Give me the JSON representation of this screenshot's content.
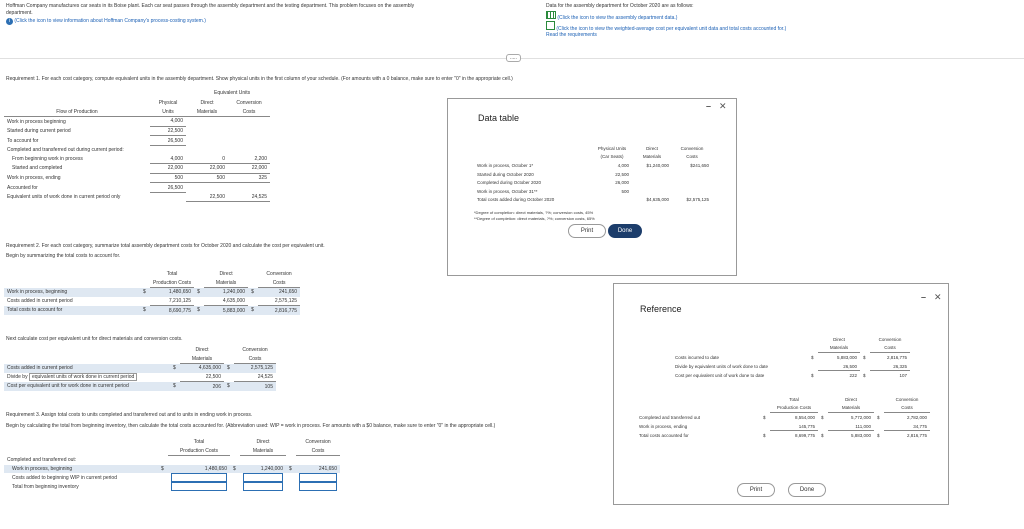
{
  "problem": {
    "intro1": "Hoffman Company manufactures car seats in its Boise plant. Each car seat passes through the assembly department and the testing department. This problem focuses on the assembly",
    "intro2": "department.",
    "link_left": "(Click the icon to view information about Hoffman Company's process-costing system.)",
    "data_intro": "Data for the assembly department for October 2020 are as follows:",
    "link_data": "(Click the icon to view the assembly department data.)",
    "link_wavg": "(Click the icon to view the weighted-average cost per equivalent unit data and total costs accounted for.)",
    "read_req": "Read the requirements",
    "collapse": "....."
  },
  "req1": {
    "title": "Requirement 1. For each cost category, compute equivalent units in the assembly department. Show physical units in the first column of your schedule. (For amounts with a 0 balance, make sure to enter \"0\" in the appropriate cell.)",
    "group_header": "Equivalent Units",
    "h_physical": "Physical",
    "h_units": "Units",
    "h_direct": "Direct",
    "h_materials": "Materials",
    "h_conv": "Conversion",
    "h_costs": "Costs",
    "h_flow": "Flow of Production",
    "rows": [
      {
        "label": "Work in process beginning",
        "p": "4,000",
        "d": "",
        "c": ""
      },
      {
        "label": "Started during current period",
        "p": "22,500",
        "d": "",
        "c": ""
      },
      {
        "label": "To account for",
        "p": "26,500",
        "d": "",
        "c": ""
      },
      {
        "label": "Completed and transferred out during current period:",
        "p": "",
        "d": "",
        "c": ""
      },
      {
        "label": "From beginning work in process",
        "p": "4,000",
        "d": "0",
        "c": "2,200"
      },
      {
        "label": "Started and completed",
        "p": "22,000",
        "d": "22,000",
        "c": "22,000"
      },
      {
        "label": "Work in process, ending",
        "p": "500",
        "d": "500",
        "c": "325"
      },
      {
        "label": "Accounted for",
        "p": "26,500",
        "d": "",
        "c": ""
      },
      {
        "label": "Equivalent units of work done in current period only",
        "p": "",
        "d": "22,500",
        "c": "24,525"
      }
    ]
  },
  "req2": {
    "title": "Requirement 2. For each cost category, summarize total assembly department costs for October 2020 and calculate the cost per equivalent unit.",
    "sub": "Begin by summarizing the total costs to account for.",
    "h_total": "Total",
    "h_prod": "Production Costs",
    "h_direct": "Direct",
    "h_materials": "Materials",
    "h_conv": "Conversion",
    "h_costs": "Costs",
    "rows": [
      {
        "label": "Work in process, beginning",
        "s1": "$",
        "t": "1,480,650",
        "s2": "$",
        "d": "1,240,000",
        "s3": "$",
        "c": "241,650"
      },
      {
        "label": "Costs added in current period",
        "s1": "",
        "t": "7,210,125",
        "s2": "",
        "d": "4,635,000",
        "s3": "",
        "c": "2,575,125"
      },
      {
        "label": "Total costs to account for",
        "s1": "$",
        "t": "8,690,775",
        "s2": "$",
        "d": "5,883,000",
        "s3": "$",
        "c": "2,816,775"
      }
    ],
    "sub2": "Next calculate cost per equivalent unit for direct materials and conversion costs.",
    "h2_direct": "Direct",
    "h2_materials": "Materials",
    "h2_conv": "Conversion",
    "h2_costs": "Costs",
    "rows2": [
      {
        "label": "Costs added in current period",
        "s1": "$",
        "d": "4,635,000",
        "s2": "$",
        "c": "2,575,125"
      },
      {
        "label": "Divide by",
        "label2": "equivalent units of work done in current period",
        "s1": "",
        "d": "22,500",
        "s2": "",
        "c": "24,525"
      },
      {
        "label": "Cost per equivalent unit for work done in current period",
        "s1": "$",
        "d": "206",
        "s2": "$",
        "c": "105"
      }
    ]
  },
  "req3": {
    "title": "Requirement 3. Assign total costs to units completed and transferred out and to units in ending work in process.",
    "sub": "Begin by calculating the total from beginning inventory, then calculate the total costs accounted for. (Abbreviation used: WIP = work in process. For amounts with a $0 balance, make sure to enter \"0\" in the appropriate cell.)",
    "h_total": "Total",
    "h_prod": "Production Costs",
    "h_direct": "Direct",
    "h_materials": "Materials",
    "h_conv": "Conversion",
    "h_costs": "Costs",
    "section": "Completed and transferred out:",
    "rows": [
      {
        "label": "Work in process, beginning",
        "s1": "$",
        "t": "1,480,650",
        "s2": "$",
        "d": "1,240,000",
        "s3": "$",
        "c": "241,650"
      },
      {
        "label": "Costs added to beginning WIP in current period",
        "t": "",
        "d": "",
        "c": ""
      },
      {
        "label": "Total from beginning inventory",
        "t": "",
        "d": "",
        "c": ""
      }
    ]
  },
  "datatable": {
    "title": "Data table",
    "h_phys": "Physical Units",
    "h_phys2": "(Car Seats)",
    "h_direct": "Direct",
    "h_materials": "Materials",
    "h_conv": "Conversion",
    "h_costs": "Costs",
    "rows": [
      {
        "label": "Work in process, October 1*",
        "p": "4,000",
        "d": "$1,240,000",
        "c": "$241,650"
      },
      {
        "label": "Started during October 2020",
        "p": "22,500",
        "d": "",
        "c": ""
      },
      {
        "label": "Completed during October 2020",
        "p": "26,000",
        "d": "",
        "c": ""
      },
      {
        "label": "Work in process, October 31**",
        "p": "500",
        "d": "",
        "c": ""
      },
      {
        "label": "Total costs added during October 2020",
        "p": "",
        "d": "$4,635,000",
        "c": "$2,575,125"
      }
    ],
    "note1": "*Degree of completion: direct materials, ?%; conversion costs, 45%",
    "note2": "**Degree of completion: direct materials, ?%; conversion costs, 65%",
    "print": "Print",
    "done": "Done"
  },
  "reference": {
    "title": "Reference",
    "h_direct": "Direct",
    "h_materials": "Materials",
    "h_conv": "Conversion",
    "h_costs": "Costs",
    "rows1": [
      {
        "label": "Costs incurred to date",
        "s1": "$",
        "d": "5,883,000",
        "s2": "$",
        "c": "2,816,775"
      },
      {
        "label": "Divide by equivalent units of work done to date",
        "d": "26,500",
        "c": "26,325"
      },
      {
        "label": "Cost per equivalent unit of work done to date",
        "s1": "$",
        "d": "222",
        "s2": "$",
        "c": "107"
      }
    ],
    "h2_total": "Total",
    "h2_prod": "Production Costs",
    "h2_direct": "Direct",
    "h2_materials": "Materials",
    "h2_conv": "Conversion",
    "h2_costs": "Costs",
    "rows2": [
      {
        "label": "Completed and transferred out",
        "s1": "$",
        "t": "8,554,000",
        "s2": "$",
        "d": "5,772,000",
        "s3": "$",
        "c": "2,782,000"
      },
      {
        "label": "Work in process, ending",
        "t": "145,775",
        "d": "111,000",
        "c": "34,775"
      },
      {
        "label": "Total costs accounted for",
        "s1": "$",
        "t": "8,699,775",
        "s2": "$",
        "d": "5,883,000",
        "s3": "$",
        "c": "2,816,775"
      }
    ],
    "print": "Print",
    "done": "Done"
  },
  "icons": {
    "info": "info-icon",
    "grid": "data-grid-icon",
    "calc": "calculator-icon",
    "close": "close-icon",
    "minimize": "minimize-icon"
  },
  "colors": {
    "link_blue": "#1a5fb4",
    "highlight": "#e2ebf5",
    "done_button": "#1c3d6b",
    "input_border": "#2c6fb3"
  }
}
